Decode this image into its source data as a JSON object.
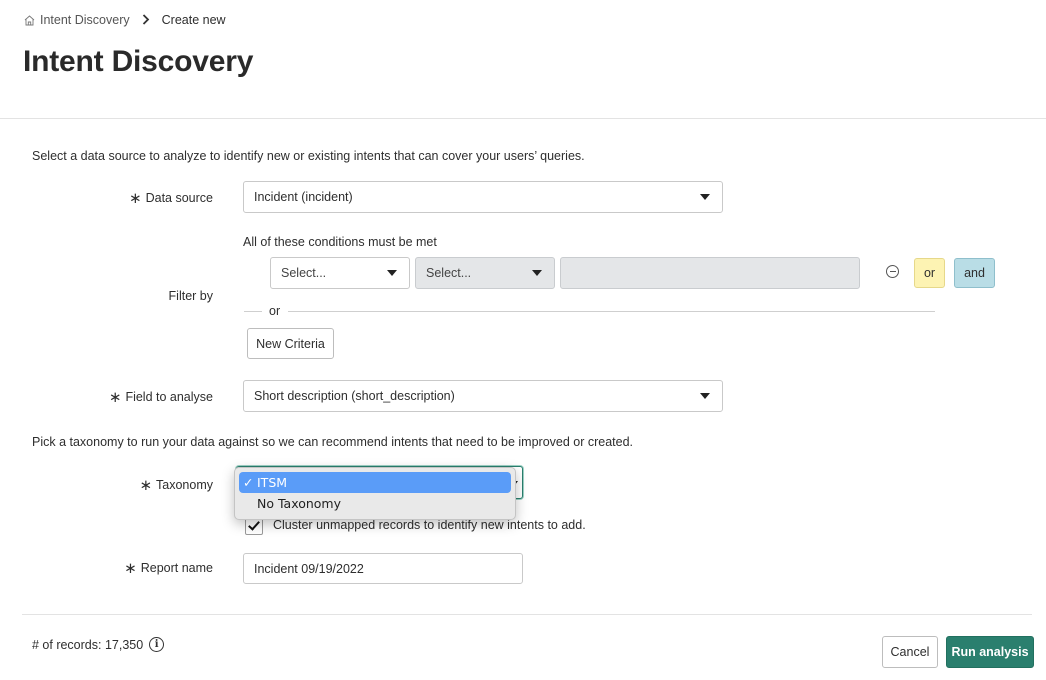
{
  "breadcrumb": {
    "home_icon": "home-icon",
    "parent": "Intent Discovery",
    "separator_icon": "chevron-right-icon",
    "current": "Create new"
  },
  "page_title": "Intent Discovery",
  "form": {
    "intro": "Select a data source to analyze to identify new or existing intents that can cover your users’ queries.",
    "required_marker": "∗",
    "data_source": {
      "label": "Data source",
      "value": "Incident (incident)"
    },
    "filter": {
      "label": "Filter by",
      "conditions_heading": "All of these conditions must be met",
      "field_placeholder": "Select...",
      "operator_placeholder": "Select...",
      "value": "",
      "remove_icon": "minus-circle-icon",
      "or_label": "or",
      "and_label": "and",
      "separator_label": "or",
      "new_criteria_label": "New Criteria"
    },
    "field_to_analyse": {
      "label": "Field to analyse",
      "value": "Short description (short_description)"
    },
    "taxonomy_intro": "Pick a taxonomy to run your data against so we can recommend intents that need to be improved or created.",
    "taxonomy": {
      "label": "Taxonomy",
      "options": [
        "ITSM",
        "No Taxonomy"
      ],
      "selected": "ITSM",
      "check_glyph": "✓"
    },
    "cluster": {
      "checked": true,
      "label": "Cluster unmapped records to identify new intents to add."
    },
    "report_name": {
      "label": "Report name",
      "value": "Incident 09/19/2022"
    }
  },
  "footer": {
    "records_label": "# of records: 17,350",
    "info_icon": "info-icon",
    "cancel_label": "Cancel",
    "run_label": "Run analysis"
  },
  "colors": {
    "primary": "#2a7f6e",
    "or_button": "#fdf3b3",
    "and_button": "#b9dde6",
    "selected_option": "#5a9cf8"
  }
}
